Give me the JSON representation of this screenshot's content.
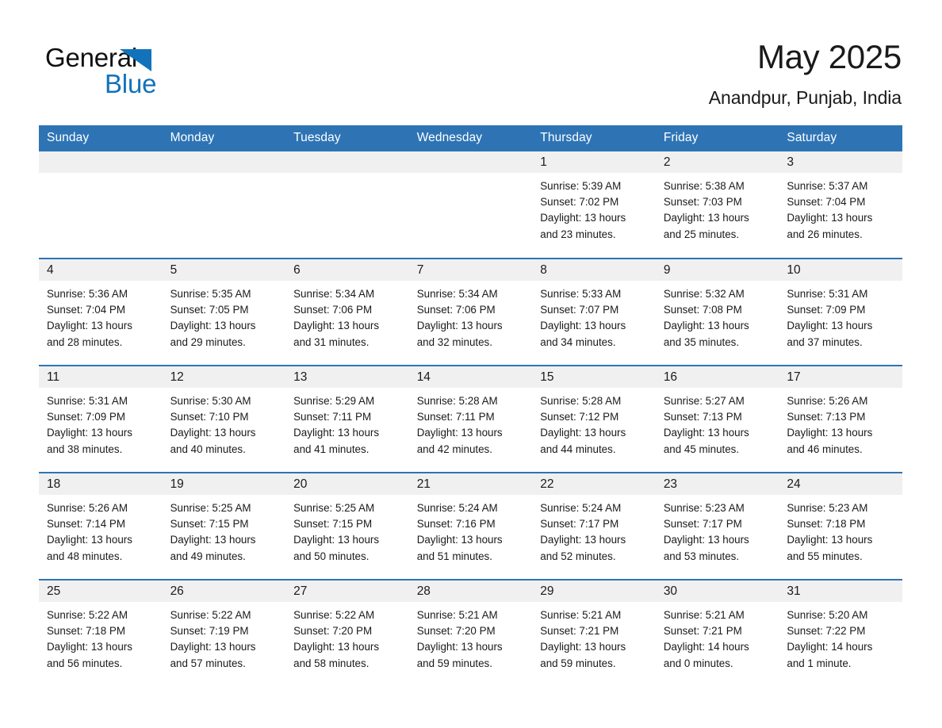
{
  "brand": {
    "name_part1": "General",
    "name_part2": "Blue",
    "triangle_color": "#1273ba",
    "accent_color": "#2e74b5"
  },
  "header": {
    "title": "May 2025",
    "subtitle": "Anandpur, Punjab, India"
  },
  "calendar": {
    "weekday_headers": [
      "Sunday",
      "Monday",
      "Tuesday",
      "Wednesday",
      "Thursday",
      "Friday",
      "Saturday"
    ],
    "weeks": [
      [
        {
          "day": "",
          "blank": true
        },
        {
          "day": "",
          "blank": true
        },
        {
          "day": "",
          "blank": true
        },
        {
          "day": "",
          "blank": true
        },
        {
          "day": "1",
          "sunrise": "Sunrise: 5:39 AM",
          "sunset": "Sunset: 7:02 PM",
          "daylight_l1": "Daylight: 13 hours",
          "daylight_l2": "and 23 minutes."
        },
        {
          "day": "2",
          "sunrise": "Sunrise: 5:38 AM",
          "sunset": "Sunset: 7:03 PM",
          "daylight_l1": "Daylight: 13 hours",
          "daylight_l2": "and 25 minutes."
        },
        {
          "day": "3",
          "sunrise": "Sunrise: 5:37 AM",
          "sunset": "Sunset: 7:04 PM",
          "daylight_l1": "Daylight: 13 hours",
          "daylight_l2": "and 26 minutes."
        }
      ],
      [
        {
          "day": "4",
          "sunrise": "Sunrise: 5:36 AM",
          "sunset": "Sunset: 7:04 PM",
          "daylight_l1": "Daylight: 13 hours",
          "daylight_l2": "and 28 minutes."
        },
        {
          "day": "5",
          "sunrise": "Sunrise: 5:35 AM",
          "sunset": "Sunset: 7:05 PM",
          "daylight_l1": "Daylight: 13 hours",
          "daylight_l2": "and 29 minutes."
        },
        {
          "day": "6",
          "sunrise": "Sunrise: 5:34 AM",
          "sunset": "Sunset: 7:06 PM",
          "daylight_l1": "Daylight: 13 hours",
          "daylight_l2": "and 31 minutes."
        },
        {
          "day": "7",
          "sunrise": "Sunrise: 5:34 AM",
          "sunset": "Sunset: 7:06 PM",
          "daylight_l1": "Daylight: 13 hours",
          "daylight_l2": "and 32 minutes."
        },
        {
          "day": "8",
          "sunrise": "Sunrise: 5:33 AM",
          "sunset": "Sunset: 7:07 PM",
          "daylight_l1": "Daylight: 13 hours",
          "daylight_l2": "and 34 minutes."
        },
        {
          "day": "9",
          "sunrise": "Sunrise: 5:32 AM",
          "sunset": "Sunset: 7:08 PM",
          "daylight_l1": "Daylight: 13 hours",
          "daylight_l2": "and 35 minutes."
        },
        {
          "day": "10",
          "sunrise": "Sunrise: 5:31 AM",
          "sunset": "Sunset: 7:09 PM",
          "daylight_l1": "Daylight: 13 hours",
          "daylight_l2": "and 37 minutes."
        }
      ],
      [
        {
          "day": "11",
          "sunrise": "Sunrise: 5:31 AM",
          "sunset": "Sunset: 7:09 PM",
          "daylight_l1": "Daylight: 13 hours",
          "daylight_l2": "and 38 minutes."
        },
        {
          "day": "12",
          "sunrise": "Sunrise: 5:30 AM",
          "sunset": "Sunset: 7:10 PM",
          "daylight_l1": "Daylight: 13 hours",
          "daylight_l2": "and 40 minutes."
        },
        {
          "day": "13",
          "sunrise": "Sunrise: 5:29 AM",
          "sunset": "Sunset: 7:11 PM",
          "daylight_l1": "Daylight: 13 hours",
          "daylight_l2": "and 41 minutes."
        },
        {
          "day": "14",
          "sunrise": "Sunrise: 5:28 AM",
          "sunset": "Sunset: 7:11 PM",
          "daylight_l1": "Daylight: 13 hours",
          "daylight_l2": "and 42 minutes."
        },
        {
          "day": "15",
          "sunrise": "Sunrise: 5:28 AM",
          "sunset": "Sunset: 7:12 PM",
          "daylight_l1": "Daylight: 13 hours",
          "daylight_l2": "and 44 minutes."
        },
        {
          "day": "16",
          "sunrise": "Sunrise: 5:27 AM",
          "sunset": "Sunset: 7:13 PM",
          "daylight_l1": "Daylight: 13 hours",
          "daylight_l2": "and 45 minutes."
        },
        {
          "day": "17",
          "sunrise": "Sunrise: 5:26 AM",
          "sunset": "Sunset: 7:13 PM",
          "daylight_l1": "Daylight: 13 hours",
          "daylight_l2": "and 46 minutes."
        }
      ],
      [
        {
          "day": "18",
          "sunrise": "Sunrise: 5:26 AM",
          "sunset": "Sunset: 7:14 PM",
          "daylight_l1": "Daylight: 13 hours",
          "daylight_l2": "and 48 minutes."
        },
        {
          "day": "19",
          "sunrise": "Sunrise: 5:25 AM",
          "sunset": "Sunset: 7:15 PM",
          "daylight_l1": "Daylight: 13 hours",
          "daylight_l2": "and 49 minutes."
        },
        {
          "day": "20",
          "sunrise": "Sunrise: 5:25 AM",
          "sunset": "Sunset: 7:15 PM",
          "daylight_l1": "Daylight: 13 hours",
          "daylight_l2": "and 50 minutes."
        },
        {
          "day": "21",
          "sunrise": "Sunrise: 5:24 AM",
          "sunset": "Sunset: 7:16 PM",
          "daylight_l1": "Daylight: 13 hours",
          "daylight_l2": "and 51 minutes."
        },
        {
          "day": "22",
          "sunrise": "Sunrise: 5:24 AM",
          "sunset": "Sunset: 7:17 PM",
          "daylight_l1": "Daylight: 13 hours",
          "daylight_l2": "and 52 minutes."
        },
        {
          "day": "23",
          "sunrise": "Sunrise: 5:23 AM",
          "sunset": "Sunset: 7:17 PM",
          "daylight_l1": "Daylight: 13 hours",
          "daylight_l2": "and 53 minutes."
        },
        {
          "day": "24",
          "sunrise": "Sunrise: 5:23 AM",
          "sunset": "Sunset: 7:18 PM",
          "daylight_l1": "Daylight: 13 hours",
          "daylight_l2": "and 55 minutes."
        }
      ],
      [
        {
          "day": "25",
          "sunrise": "Sunrise: 5:22 AM",
          "sunset": "Sunset: 7:18 PM",
          "daylight_l1": "Daylight: 13 hours",
          "daylight_l2": "and 56 minutes."
        },
        {
          "day": "26",
          "sunrise": "Sunrise: 5:22 AM",
          "sunset": "Sunset: 7:19 PM",
          "daylight_l1": "Daylight: 13 hours",
          "daylight_l2": "and 57 minutes."
        },
        {
          "day": "27",
          "sunrise": "Sunrise: 5:22 AM",
          "sunset": "Sunset: 7:20 PM",
          "daylight_l1": "Daylight: 13 hours",
          "daylight_l2": "and 58 minutes."
        },
        {
          "day": "28",
          "sunrise": "Sunrise: 5:21 AM",
          "sunset": "Sunset: 7:20 PM",
          "daylight_l1": "Daylight: 13 hours",
          "daylight_l2": "and 59 minutes."
        },
        {
          "day": "29",
          "sunrise": "Sunrise: 5:21 AM",
          "sunset": "Sunset: 7:21 PM",
          "daylight_l1": "Daylight: 13 hours",
          "daylight_l2": "and 59 minutes."
        },
        {
          "day": "30",
          "sunrise": "Sunrise: 5:21 AM",
          "sunset": "Sunset: 7:21 PM",
          "daylight_l1": "Daylight: 14 hours",
          "daylight_l2": "and 0 minutes."
        },
        {
          "day": "31",
          "sunrise": "Sunrise: 5:20 AM",
          "sunset": "Sunset: 7:22 PM",
          "daylight_l1": "Daylight: 14 hours",
          "daylight_l2": "and 1 minute."
        }
      ]
    ]
  }
}
